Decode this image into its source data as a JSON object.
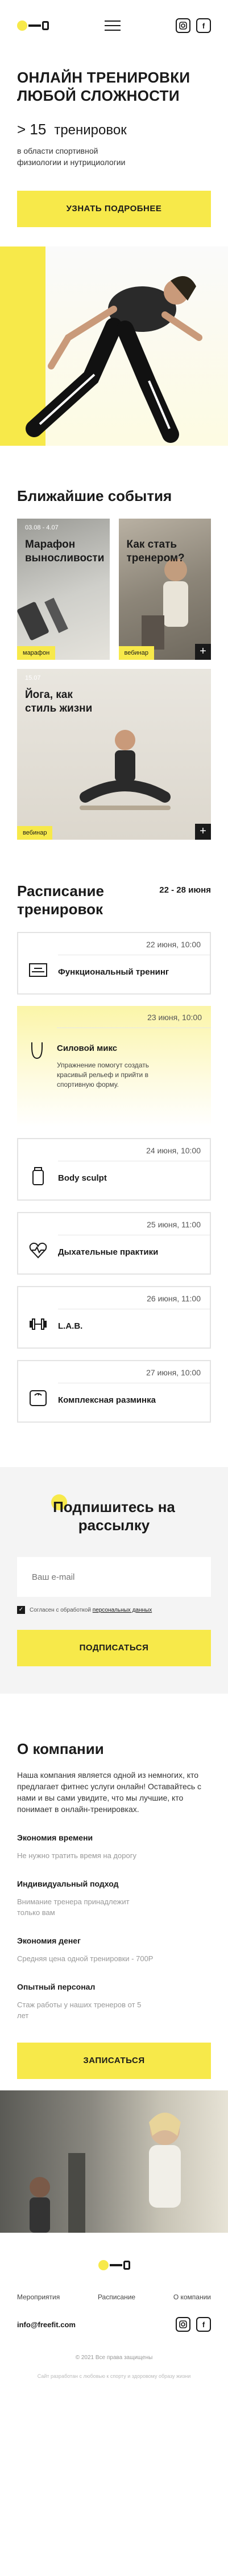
{
  "colors": {
    "accent": "#f7e94a",
    "dark": "#1a1a1a"
  },
  "header": {
    "icons": [
      "logo-dumbbell-icon",
      "menu-icon",
      "instagram-icon",
      "facebook-icon"
    ]
  },
  "hero": {
    "title": "ОНЛАЙН ТРЕНИРОВКИ ЛЮБОЙ СЛОЖНОСТИ",
    "stat_num": "> 15",
    "stat_text": "тренировок",
    "subtitle": "в области спортивной физиологии и нутрициологии",
    "cta": "УЗНАТЬ ПОДРОБНЕЕ"
  },
  "events": {
    "title": "Ближайшие события",
    "items": [
      {
        "date": "03.08 - 4.07",
        "title": "Марафон выносливости",
        "tag": "марафон"
      },
      {
        "date": "",
        "title": "Как стать тренером?",
        "tag": "вебинар"
      },
      {
        "date": "15.07",
        "title": "Йога, как стиль жизни",
        "tag": "вебинар"
      }
    ]
  },
  "schedule": {
    "title": "Расписание тренировок",
    "range": "22 - 28 июня",
    "items": [
      {
        "when": "22 июня, 10:00",
        "name": "Функциональный тренинг",
        "icon": "dumbbell-rack-icon"
      },
      {
        "when": "23 июня, 10:00",
        "name": "Силовой микс",
        "icon": "jump-rope-icon",
        "desc": "Упражнение помогут создать красивый рельеф и прийти в спортивную форму."
      },
      {
        "when": "24 июня, 10:00",
        "name": "Body sculpt",
        "icon": "water-bottle-icon"
      },
      {
        "when": "25 июня, 11:00",
        "name": "Дыхательные практики",
        "icon": "heart-pulse-icon"
      },
      {
        "when": "26 июня, 11:00",
        "name": "L.A.B.",
        "icon": "dumbbell-icon"
      },
      {
        "when": "27 июня, 10:00",
        "name": "Комплексная разминка",
        "icon": "scale-icon"
      }
    ]
  },
  "subscribe": {
    "title": "Подпишитесь на рассылку",
    "placeholder": "Ваш e-mail",
    "consent_prefix": "Согласен с обработкой",
    "consent_link": "персональных данных",
    "cta": "ПОДПИСАТЬСЯ"
  },
  "about": {
    "title": "О компании",
    "intro": "Наша компания является одной из немногих, кто предлагает фитнес услуги онлайн! Оставайтесь с нами и вы сами увидите, что мы лучшие, кто понимает в онлайн-тренировках.",
    "features": [
      {
        "title": "Экономия времени",
        "text": "Не нужно тратить время на дорогу"
      },
      {
        "title": "Индивидуальный подход",
        "text": "Внимание тренера принадлежит только вам"
      },
      {
        "title": "Экономия денег",
        "text": "Средняя цена одной тренировки - 700Р"
      },
      {
        "title": "Опытный персонал",
        "text": "Стаж работы у наших тренеров от 5 лет"
      }
    ],
    "cta": "ЗАПИСАТЬСЯ"
  },
  "footer": {
    "nav": [
      "Мероприятия",
      "Расписание",
      "О компании"
    ],
    "email": "info@freefit.com",
    "copyright": "© 2021 Все права защищены",
    "bottom": "Сайт разработан с любовью к спорту и здоровому образу жизни"
  }
}
